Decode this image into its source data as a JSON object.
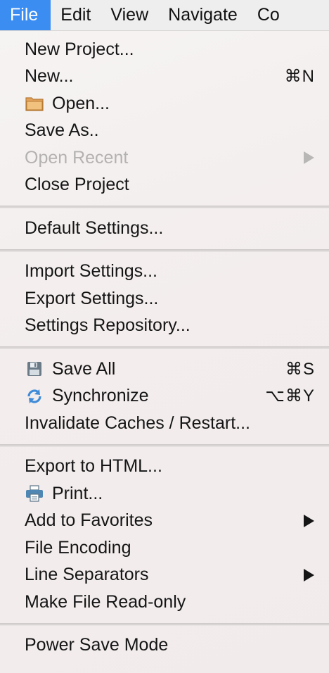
{
  "menubar": {
    "items": [
      "File",
      "Edit",
      "View",
      "Navigate",
      "Co"
    ],
    "active": "File"
  },
  "menu": {
    "groups": [
      [
        {
          "label": "New Project...",
          "shortcut": "",
          "submenu": false,
          "disabled": false,
          "icon": ""
        },
        {
          "label": "New...",
          "shortcut": "⌘N",
          "submenu": false,
          "disabled": false,
          "icon": ""
        },
        {
          "label": "Open...",
          "shortcut": "",
          "submenu": false,
          "disabled": false,
          "icon": "folder-icon"
        },
        {
          "label": "Save As..",
          "shortcut": "",
          "submenu": false,
          "disabled": false,
          "icon": ""
        },
        {
          "label": "Open Recent",
          "shortcut": "",
          "submenu": true,
          "disabled": true,
          "icon": ""
        },
        {
          "label": "Close Project",
          "shortcut": "",
          "submenu": false,
          "disabled": false,
          "icon": ""
        }
      ],
      [
        {
          "label": "Default Settings...",
          "shortcut": "",
          "submenu": false,
          "disabled": false,
          "icon": ""
        }
      ],
      [
        {
          "label": "Import Settings...",
          "shortcut": "",
          "submenu": false,
          "disabled": false,
          "icon": ""
        },
        {
          "label": "Export Settings...",
          "shortcut": "",
          "submenu": false,
          "disabled": false,
          "icon": ""
        },
        {
          "label": "Settings Repository...",
          "shortcut": "",
          "submenu": false,
          "disabled": false,
          "icon": ""
        }
      ],
      [
        {
          "label": "Save All",
          "shortcut": "⌘S",
          "submenu": false,
          "disabled": false,
          "icon": "floppy-disk-icon"
        },
        {
          "label": "Synchronize",
          "shortcut": "⌥⌘Y",
          "submenu": false,
          "disabled": false,
          "icon": "sync-icon"
        },
        {
          "label": "Invalidate Caches / Restart...",
          "shortcut": "",
          "submenu": false,
          "disabled": false,
          "icon": ""
        }
      ],
      [
        {
          "label": "Export to HTML...",
          "shortcut": "",
          "submenu": false,
          "disabled": false,
          "icon": ""
        },
        {
          "label": "Print...",
          "shortcut": "",
          "submenu": false,
          "disabled": false,
          "icon": "printer-icon"
        },
        {
          "label": "Add to Favorites",
          "shortcut": "",
          "submenu": true,
          "disabled": false,
          "icon": ""
        },
        {
          "label": "File Encoding",
          "shortcut": "",
          "submenu": false,
          "disabled": false,
          "icon": ""
        },
        {
          "label": "Line Separators",
          "shortcut": "",
          "submenu": true,
          "disabled": false,
          "icon": ""
        },
        {
          "label": "Make File Read-only",
          "shortcut": "",
          "submenu": false,
          "disabled": false,
          "icon": ""
        }
      ],
      [
        {
          "label": "Power Save Mode",
          "shortcut": "",
          "submenu": false,
          "disabled": false,
          "icon": ""
        }
      ]
    ]
  },
  "colors": {
    "accent": "#3b8df1",
    "disabled_text": "#b4b1b1",
    "menu_bg": "#f3eeee"
  }
}
